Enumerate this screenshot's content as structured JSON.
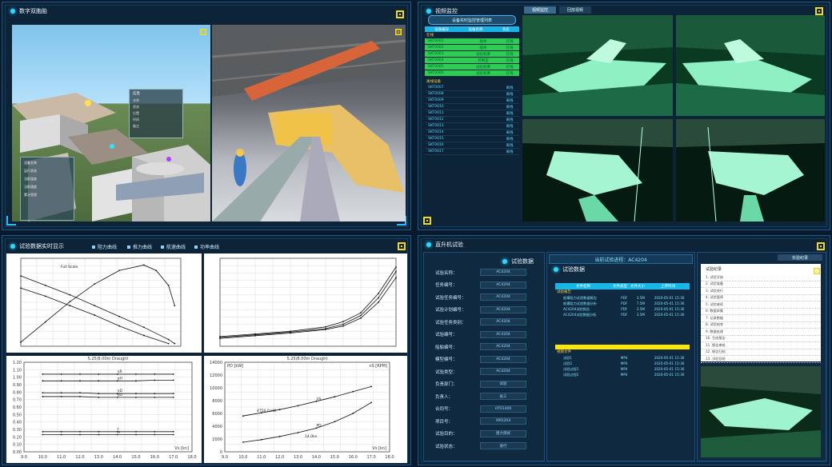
{
  "panels": {
    "tl_title": "数字双胞胎",
    "tr_title": "视频监控",
    "bl_title": "试验数据实时显示",
    "br_title": "直升机试验",
    "br_center_header": "试验数据",
    "br_right_header": "试验数据",
    "br_mid_title": "当前试验进程：AC4204",
    "br_right_tab": "实验纪录"
  },
  "scene_tooltip": {
    "title": "信息",
    "rows": [
      "名称",
      "状态",
      "位置",
      "时间",
      "备注"
    ]
  },
  "side_info": {
    "rows": [
      "设备名称",
      "运行状态",
      "当前温度",
      "当前速度",
      "累计里程"
    ]
  },
  "video": {
    "tabs": [
      "视频监控",
      "回放视频"
    ],
    "sub_button": "设备实时监控管理列表",
    "list_header": [
      "设备编号",
      "设备名称",
      "状态"
    ],
    "group_online": "在线",
    "group_offline": "离线设备",
    "online_items": [
      {
        "id": "SKT0001",
        "name": "船体",
        "state": "在线"
      },
      {
        "id": "SKT0002",
        "name": "船体",
        "state": "在线"
      },
      {
        "id": "SKT0003",
        "name": "试验机库",
        "state": "在线"
      },
      {
        "id": "SKT0004",
        "name": "控制室",
        "state": "在线"
      },
      {
        "id": "SKT0005",
        "name": "试验机库",
        "state": "在线"
      },
      {
        "id": "SKT0006",
        "name": "试验机库",
        "state": "在线"
      }
    ],
    "offline_items": [
      {
        "id": "SKT0007",
        "state": "离线"
      },
      {
        "id": "SKT0008",
        "state": "离线"
      },
      {
        "id": "SKT0009",
        "state": "离线"
      },
      {
        "id": "SKT0010",
        "state": "离线"
      },
      {
        "id": "SKT0011",
        "state": "离线"
      },
      {
        "id": "SKT0012",
        "state": "离线"
      },
      {
        "id": "SKT0013",
        "state": "离线"
      },
      {
        "id": "SKT0014",
        "state": "离线"
      },
      {
        "id": "SKT0015",
        "state": "离线"
      },
      {
        "id": "SKT0016",
        "state": "离线"
      },
      {
        "id": "SKT0017",
        "state": "离线"
      }
    ]
  },
  "chart_tabs": [
    "阻力曲线",
    "推力曲线",
    "航速曲线",
    "功率曲线"
  ],
  "fields": [
    {
      "label": "试验名称：",
      "value": "AC4204"
    },
    {
      "label": "任务编号：",
      "value": "AC4204"
    },
    {
      "label": "试验任务编号：",
      "value": "AC4204"
    },
    {
      "label": "试验计划编号：",
      "value": "AC4204"
    },
    {
      "label": "试验任务类别：",
      "value": "AC4204"
    },
    {
      "label": "试验编号：",
      "value": "AC4204"
    },
    {
      "label": "船舶编号：",
      "value": "AC4204"
    },
    {
      "label": "模型编号：",
      "value": "AC4204"
    },
    {
      "label": "试验类型：",
      "value": "AC4204"
    },
    {
      "label": "负责部门：",
      "value": "试验"
    },
    {
      "label": "负责人：",
      "value": "张三"
    },
    {
      "label": "合同号：",
      "value": "HT01406"
    },
    {
      "label": "项目号：",
      "value": "XM1204"
    },
    {
      "label": "试验目的：",
      "value": "阻力测试"
    },
    {
      "label": "试验状态：",
      "value": "进行"
    }
  ],
  "doc_table": {
    "headers": [
      "文件名称",
      "文件类型",
      "文件大小",
      "上传时间"
    ],
    "section1": "试验报告",
    "rows1": [
      {
        "name": "船模阻力试验数据报告",
        "type": "PDF",
        "size": "3.5M",
        "time": "2020-05-01 15:36"
      },
      {
        "name": "船模阻力试验数据分析",
        "type": "PDF",
        "size": "7.5M",
        "time": "2020-05-01 15:36"
      },
      {
        "name": "AC4204试验报告",
        "type": "PDF",
        "size": "3.5M",
        "time": "2020-05-01 15:36"
      },
      {
        "name": "AC4204试验数据分析",
        "type": "PDF",
        "size": "3.5M",
        "time": "2020-05-01 15:36"
      }
    ],
    "section2": "视频文件",
    "rows2": [
      {
        "name": "试验1",
        "type": "MP4",
        "size": "",
        "time": "2020-05-01 15:36"
      },
      {
        "name": "试验2",
        "type": "MP4",
        "size": "",
        "time": "2020-05-01 15:36"
      },
      {
        "name": "试验过程1",
        "type": "MP4",
        "size": "",
        "time": "2020-05-01 15:36"
      },
      {
        "name": "试验过程2",
        "type": "MP4",
        "size": "",
        "time": "2020-05-01 15:36"
      }
    ]
  },
  "record_list": {
    "header": "试验纪录",
    "items": [
      "1. 试验开始",
      "2. 试验准备",
      "3. 试验进行",
      "4. 试验暂停",
      "5. 试验继续",
      "6. 数据采集",
      "7. 记录数据",
      "8. 试验结束",
      "9. 数据处理",
      "10. 生成报告",
      "11. 报告审核",
      "12. 报告归档",
      "13. 试验总结"
    ]
  },
  "chart_data": [
    {
      "type": "line",
      "title": "",
      "legend": [
        "Full Scale"
      ],
      "xlim": [
        0.0,
        1.3
      ],
      "ylim": [
        0.0,
        0.65
      ],
      "series": [
        {
          "name": "",
          "x": [
            0.0,
            0.2,
            0.4,
            0.6,
            0.8,
            1.0,
            1.1,
            1.2,
            1.25
          ],
          "y": [
            0.03,
            0.18,
            0.33,
            0.46,
            0.56,
            0.6,
            0.56,
            0.45,
            0.3
          ]
        },
        {
          "name": "",
          "x": [
            0.0,
            0.2,
            0.4,
            0.6,
            0.8,
            1.0,
            1.2,
            1.25
          ],
          "y": [
            0.52,
            0.45,
            0.38,
            0.3,
            0.22,
            0.14,
            0.05,
            0.02
          ]
        },
        {
          "name": "",
          "x": [
            0.0,
            0.2,
            0.4,
            0.6,
            0.8,
            1.0,
            1.2
          ],
          "y": [
            0.43,
            0.37,
            0.3,
            0.23,
            0.15,
            0.08,
            0.02
          ]
        }
      ]
    },
    {
      "type": "line",
      "xlim": [
        0,
        10
      ],
      "ylim": [
        0,
        10
      ],
      "series": [
        {
          "name": "",
          "x": [
            0,
            2,
            4,
            6,
            7,
            8,
            9,
            10
          ],
          "y": [
            1.0,
            1.3,
            1.6,
            2.0,
            2.5,
            3.5,
            5.5,
            8.5
          ]
        },
        {
          "name": "",
          "x": [
            0,
            2,
            4,
            6,
            7,
            8,
            9,
            10
          ],
          "y": [
            1.1,
            1.4,
            1.7,
            2.2,
            2.8,
            3.8,
            6.0,
            9.0
          ]
        },
        {
          "name": "",
          "x": [
            0,
            2,
            4,
            6,
            7,
            8,
            9,
            10
          ],
          "y": [
            0.9,
            1.2,
            1.5,
            1.9,
            2.3,
            3.2,
            5.0,
            7.8
          ]
        }
      ]
    },
    {
      "type": "line",
      "title": "5.25/8.00m Draught",
      "xlabel": "Vs [kn]",
      "xlim": [
        9.0,
        18.0
      ],
      "ylim": [
        0.0,
        1.2
      ],
      "xticks": [
        "9.0",
        "10.0",
        "11.0",
        "12.0",
        "13.0",
        "14.0",
        "15.0",
        "16.0",
        "17.0",
        "18.0"
      ],
      "yticks": [
        "0.00",
        "0.10",
        "0.20",
        "0.30",
        "0.40",
        "0.50",
        "0.60",
        "0.70",
        "0.80",
        "0.90",
        "1.00",
        "1.10",
        "1.20"
      ],
      "series": [
        {
          "name": "ηR",
          "x": [
            10,
            11,
            12,
            13,
            14,
            15,
            16,
            17
          ],
          "y": [
            1.04,
            1.04,
            1.04,
            1.04,
            1.04,
            1.04,
            1.04,
            1.04
          ]
        },
        {
          "name": "ηH",
          "x": [
            10,
            11,
            12,
            13,
            14,
            15,
            16,
            17
          ],
          "y": [
            0.95,
            0.95,
            0.95,
            0.95,
            0.95,
            0.95,
            0.96,
            0.96
          ]
        },
        {
          "name": "ηD",
          "x": [
            10,
            11,
            12,
            13,
            14,
            15,
            16,
            17
          ],
          "y": [
            0.79,
            0.79,
            0.79,
            0.78,
            0.78,
            0.78,
            0.78,
            0.78
          ]
        },
        {
          "name": "ηO",
          "x": [
            10,
            11,
            12,
            13,
            14,
            15,
            16,
            17
          ],
          "y": [
            0.74,
            0.74,
            0.74,
            0.73,
            0.73,
            0.73,
            0.73,
            0.73
          ]
        },
        {
          "name": "t",
          "x": [
            10,
            11,
            12,
            13,
            14,
            15,
            16,
            17
          ],
          "y": [
            0.27,
            0.27,
            0.27,
            0.27,
            0.27,
            0.27,
            0.27,
            0.27
          ]
        },
        {
          "name": "w",
          "x": [
            10,
            11,
            12,
            13,
            14,
            15,
            16,
            17
          ],
          "y": [
            0.23,
            0.23,
            0.23,
            0.23,
            0.23,
            0.23,
            0.23,
            0.23
          ]
        }
      ]
    },
    {
      "type": "line",
      "title": "5.25/8.00m Draught",
      "xlabel": "Vs [kn]",
      "ylabel": "PD [kW]",
      "ylabel2": "nS [RPM]",
      "xlim": [
        9.0,
        18.0
      ],
      "ylim": [
        0,
        14000
      ],
      "xticks": [
        "9.0",
        "10.0",
        "11.0",
        "12.0",
        "13.0",
        "14.0",
        "15.0",
        "16.0",
        "17.0",
        "18.0"
      ],
      "yticks": [
        "0",
        "2000",
        "4000",
        "6000",
        "8000",
        "10000",
        "12000",
        "14000"
      ],
      "series": [
        {
          "name": "nS",
          "x": [
            10,
            11,
            12,
            13,
            14,
            15,
            16,
            17
          ],
          "y": [
            5600,
            6100,
            6600,
            7200,
            7900,
            8600,
            9400,
            10200
          ]
        },
        {
          "name": "PD",
          "x": [
            10,
            11,
            12,
            13,
            14,
            15,
            16,
            17
          ],
          "y": [
            1500,
            1900,
            2400,
            3000,
            3700,
            4700,
            6000,
            7700
          ]
        }
      ],
      "annotations": [
        "4750.0 kW",
        "14.0kn"
      ]
    }
  ]
}
